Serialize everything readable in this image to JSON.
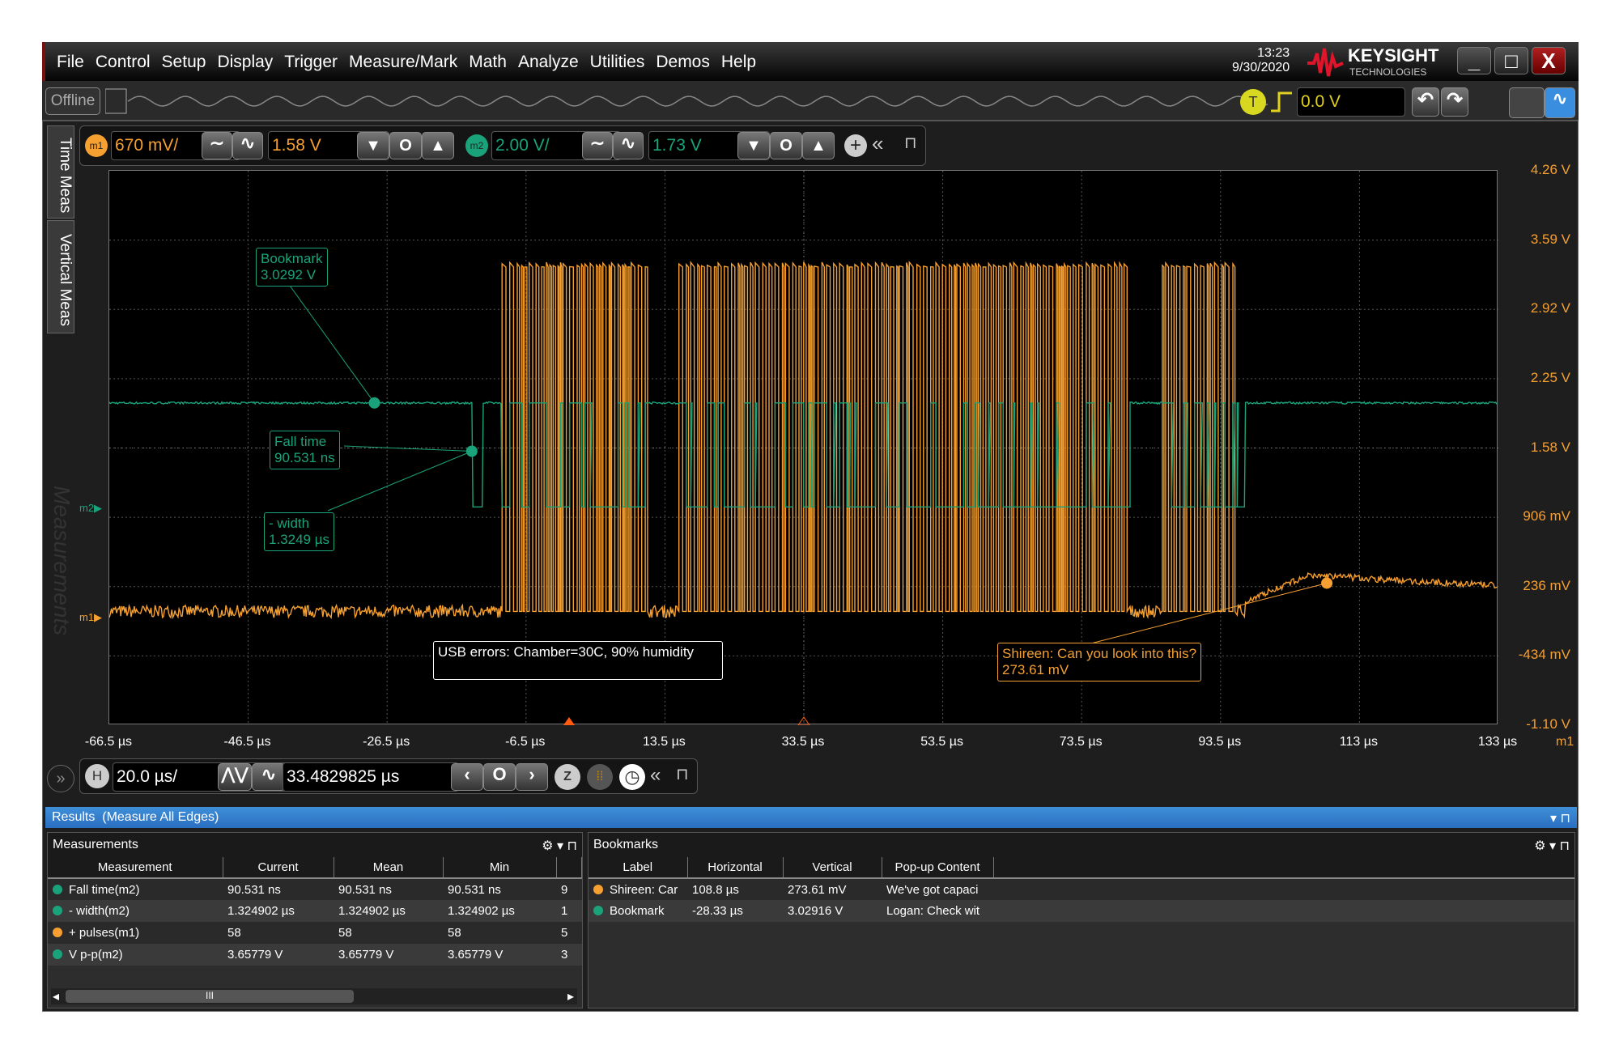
{
  "menu": [
    "File",
    "Control",
    "Setup",
    "Display",
    "Trigger",
    "Measure/Mark",
    "Math",
    "Analyze",
    "Utilities",
    "Demos",
    "Help"
  ],
  "clock": {
    "time": "13:23",
    "date": "9/30/2020"
  },
  "brand": {
    "name": "KEYSIGHT",
    "sub": "TECHNOLOGIES",
    "color": "#e0142a"
  },
  "toolbar": {
    "offline": "Offline",
    "trigger_badge": "T",
    "trigger_level": "0.0 V"
  },
  "channels": [
    {
      "badge": "m1",
      "scale": "670 mV/",
      "offset": "1.58 V",
      "color": "#f5a030"
    },
    {
      "badge": "m2",
      "scale": "2.00 V/",
      "offset": "1.73 V",
      "color": "#1aa37a"
    }
  ],
  "side_tabs": [
    "Time Meas",
    "Vertical Meas",
    "Measurements"
  ],
  "chart_data": {
    "type": "line",
    "x_ticks": [
      "-66.5 µs",
      "-46.5 µs",
      "-26.5 µs",
      "-6.5 µs",
      "13.5 µs",
      "33.5 µs",
      "53.5 µs",
      "73.5 µs",
      "93.5 µs",
      "113 µs",
      "133 µs"
    ],
    "y_ticks": [
      "4.26 V",
      "3.59 V",
      "2.92 V",
      "2.25 V",
      "1.58 V",
      "906 mV",
      "236 mV",
      "-434 mV",
      "-1.10 V"
    ],
    "xlim_us": [
      -66.5,
      133.5
    ],
    "ylim_v": [
      -1.1,
      4.26
    ],
    "y_axis_channel": "m1",
    "grid": true,
    "series": [
      {
        "name": "m1",
        "color": "#f5a030",
        "low_v": 0.0,
        "high_v": 3.33
      },
      {
        "name": "m2",
        "color": "#1aa37a",
        "low_v": 0.03,
        "high_v": 3.03
      }
    ],
    "annotations": [
      {
        "title": "Bookmark",
        "value": "3.0292 V",
        "color": "#1aa37a",
        "t_us": -28.33
      },
      {
        "title": "Fall time",
        "value": "90.531 ns",
        "color": "#1aa37a",
        "t_us": -14.3
      },
      {
        "title": "- width",
        "value": "1.3249 µs",
        "color": "#1aa37a"
      },
      {
        "title": "USB errors: Chamber=30C, 90% humidity",
        "value": "",
        "color": "#ffffff"
      },
      {
        "title": "Shireen: Can you look into this?",
        "value": "273.61 mV",
        "color": "#f5a030",
        "t_us": 108.8
      }
    ]
  },
  "horizontal": {
    "badge": "H",
    "scale": "20.0 µs/",
    "position": "33.4829825 µs"
  },
  "results": {
    "title": "Results",
    "subtitle": "(Measure All Edges)"
  },
  "measurements": {
    "title": "Measurements",
    "columns": [
      "Measurement",
      "Current",
      "Mean",
      "Min"
    ],
    "rows": [
      {
        "n": "1",
        "color": "#1aa37a",
        "name": "Fall time(m2)",
        "current": "90.531 ns",
        "mean": "90.531 ns",
        "min": "90.531 ns",
        "extra": "9"
      },
      {
        "n": "2",
        "color": "#1aa37a",
        "name": "- width(m2)",
        "current": "1.324902 µs",
        "mean": "1.324902 µs",
        "min": "1.324902 µs",
        "extra": "1"
      },
      {
        "n": "4",
        "color": "#f5a030",
        "name": "+ pulses(m1)",
        "current": "58",
        "mean": "58",
        "min": "58",
        "extra": "5"
      },
      {
        "n": "5",
        "color": "#1aa37a",
        "name": "V p-p(m2)",
        "current": "3.65779 V",
        "mean": "3.65779 V",
        "min": "3.65779 V",
        "extra": "3"
      }
    ]
  },
  "bookmarks": {
    "title": "Bookmarks",
    "columns": [
      "Label",
      "Horizontal",
      "Vertical",
      "Pop-up Content"
    ],
    "rows": [
      {
        "color": "#f5a030",
        "label": "Shireen: Car",
        "horizontal": "108.8 µs",
        "vertical": "273.61 mV",
        "content": "We've got capaci"
      },
      {
        "color": "#1aa37a",
        "label": "Bookmark",
        "horizontal": "-28.33 µs",
        "vertical": "3.02916 V",
        "content": "Logan: Check wit"
      }
    ]
  }
}
